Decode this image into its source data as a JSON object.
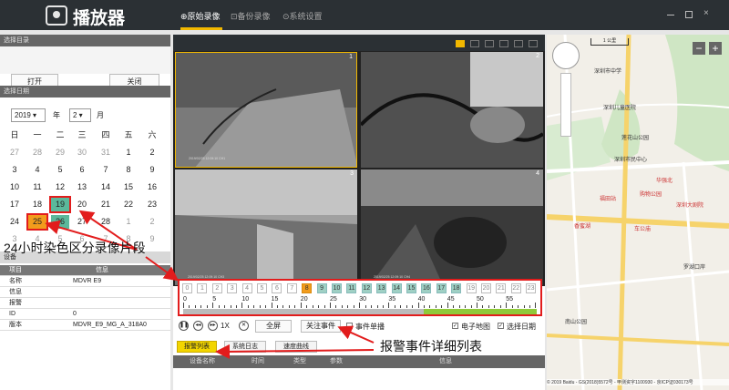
{
  "app": {
    "title": "播放器"
  },
  "tabs": [
    {
      "label": "⊕原始录像",
      "active": true
    },
    {
      "label": "⊡备份录像",
      "active": false
    },
    {
      "label": "⊙系统设置",
      "active": false
    }
  ],
  "left": {
    "dir_header": "选择目录",
    "open_label": "打开",
    "close_label": "关闭",
    "date_header": "选择日期",
    "year_value": "2019",
    "year_suffix": "年",
    "month_value": "2",
    "month_suffix": "月",
    "weekdays": [
      "日",
      "一",
      "二",
      "三",
      "四",
      "五",
      "六"
    ],
    "days": [
      [
        "27",
        "28",
        "29",
        "30",
        "31",
        "1",
        "2"
      ],
      [
        "3",
        "4",
        "5",
        "6",
        "7",
        "8",
        "9"
      ],
      [
        "10",
        "11",
        "12",
        "13",
        "14",
        "15",
        "16"
      ],
      [
        "17",
        "18",
        "19",
        "20",
        "21",
        "22",
        "23"
      ],
      [
        "24",
        "25",
        "26",
        "27",
        "28",
        "1",
        "2"
      ],
      [
        "3",
        "4",
        "5",
        "6",
        "7",
        "8",
        "9"
      ]
    ],
    "device": {
      "header": "设备",
      "col_item": "项目",
      "col_info": "信息",
      "rows": [
        {
          "k": "名称",
          "v": "MDVR E9"
        },
        {
          "k": "信息",
          "v": ""
        },
        {
          "k": "报警",
          "v": ""
        },
        {
          "k": "ID",
          "v": "0"
        },
        {
          "k": "版本",
          "v": "MDVR_E9_MG_A_318A0"
        }
      ]
    }
  },
  "center": {
    "video_nums": [
      "1",
      "2",
      "3",
      "4"
    ],
    "timestamps": [
      "2019/02/25 12:09:10  CH1",
      "2019/02/25 12:09:10  CH2",
      "2019/02/25 12:09:10  CH3",
      "2019/02/25 12:09:10  CH4"
    ],
    "hours": [
      "0",
      "1",
      "2",
      "3",
      "4",
      "5",
      "6",
      "7",
      "8",
      "9",
      "10",
      "11",
      "12",
      "13",
      "14",
      "15",
      "16",
      "17",
      "18",
      "19",
      "20",
      "21",
      "22",
      "23"
    ],
    "hour_recorded": [
      8,
      9,
      10,
      11,
      12,
      13,
      14,
      15,
      16,
      17,
      18
    ],
    "hour_alarm": [
      8
    ],
    "minute_ticks": [
      "0",
      "5",
      "10",
      "15",
      "20",
      "25",
      "30",
      "35",
      "40",
      "45",
      "50",
      "55"
    ],
    "speed_label": "1X",
    "fullscreen_label": "全屏",
    "alarm_event_label": "关注事件",
    "single_event_label": "事件单播",
    "e_map_label": "电子地图",
    "select_date_label": "选择日期",
    "event_tabs": [
      "报警列表",
      "系统日志",
      "速度曲线"
    ],
    "event_headers": [
      "设备名称",
      "时间",
      "类型",
      "参数",
      "信息"
    ]
  },
  "map": {
    "scale_label": "1 公里",
    "labels": [
      {
        "t": "深圳市中学",
        "metro": false
      },
      {
        "t": "深圳儿童医院",
        "metro": false
      },
      {
        "t": "莲花山公园",
        "metro": false
      },
      {
        "t": "深圳市民中心",
        "metro": false
      },
      {
        "t": "福田站",
        "metro": true
      },
      {
        "t": "购物公园",
        "metro": true
      },
      {
        "t": "车公庙",
        "metro": true
      },
      {
        "t": "香蜜湖",
        "metro": true
      },
      {
        "t": "华强北",
        "metro": true
      },
      {
        "t": "深圳大剧院",
        "metro": true
      },
      {
        "t": "南山公园",
        "metro": false
      },
      {
        "t": "罗湖口岸",
        "metro": false
      }
    ],
    "copyright": "© 2019 Baidu - GS(2018)5572号 - 甲测资字1100930 - 京ICP证030173号"
  },
  "annotations": {
    "calendar_note": "24小时染色区分录像片段",
    "event_note": "报警事件详细列表"
  }
}
